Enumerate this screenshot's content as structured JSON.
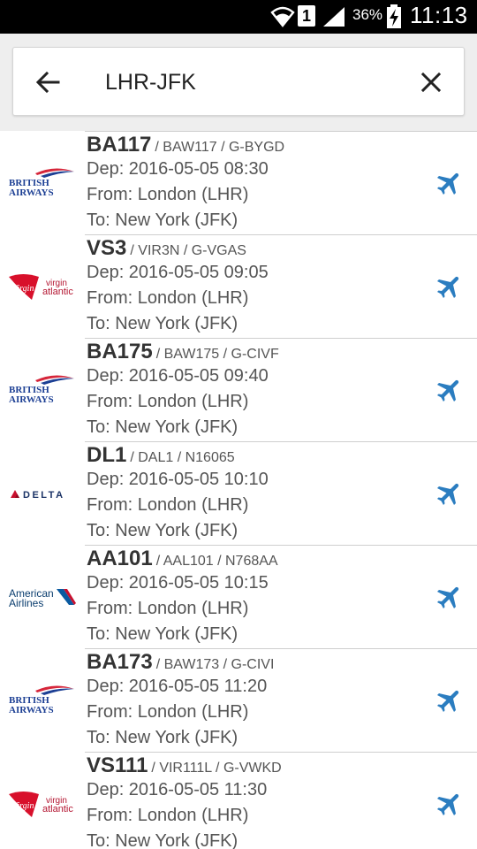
{
  "status_bar": {
    "sim_label": "1",
    "battery_percent": "36%",
    "time": "11:13",
    "icons": [
      "wifi-icon",
      "signal-icon",
      "battery-charging-icon"
    ]
  },
  "search": {
    "value": "LHR-JFK",
    "back_icon": "arrow-left-icon",
    "clear_icon": "close-icon"
  },
  "colors": {
    "plane_icon": "#2b7dc0",
    "ba_blue": "#1c3f94",
    "ba_red": "#d6263a",
    "virgin_red": "#d8102b",
    "delta_red": "#c8102e",
    "delta_blue": "#1b3366",
    "aa_blue": "#0a5aa0",
    "aa_red": "#c8102e"
  },
  "flights": [
    {
      "airline": "British Airways",
      "logo_text": [
        "BRITISH",
        "AIRWAYS"
      ],
      "number": "BA117",
      "ids": "/ BAW117 / G-BYGD",
      "dep": "Dep: 2016-05-05 08:30",
      "from": "From: London (LHR)",
      "to": "To: New York (JFK)"
    },
    {
      "airline": "Virgin Atlantic",
      "logo_text": [
        "Virgin",
        "virgin",
        "atlantic"
      ],
      "number": "VS3",
      "ids": "/ VIR3N / G-VGAS",
      "dep": "Dep: 2016-05-05 09:05",
      "from": "From: London (LHR)",
      "to": "To: New York (JFK)"
    },
    {
      "airline": "British Airways",
      "logo_text": [
        "BRITISH",
        "AIRWAYS"
      ],
      "number": "BA175",
      "ids": "/ BAW175 / G-CIVF",
      "dep": "Dep: 2016-05-05 09:40",
      "from": "From: London (LHR)",
      "to": "To: New York (JFK)"
    },
    {
      "airline": "Delta",
      "logo_text": [
        "DELTA"
      ],
      "number": "DL1",
      "ids": "/ DAL1 / N16065",
      "dep": "Dep: 2016-05-05 10:10",
      "from": "From: London (LHR)",
      "to": "To: New York (JFK)"
    },
    {
      "airline": "American Airlines",
      "logo_text": [
        "American",
        "Airlines"
      ],
      "number": "AA101",
      "ids": "/ AAL101 / N768AA",
      "dep": "Dep: 2016-05-05 10:15",
      "from": "From: London (LHR)",
      "to": "To: New York (JFK)"
    },
    {
      "airline": "British Airways",
      "logo_text": [
        "BRITISH",
        "AIRWAYS"
      ],
      "number": "BA173",
      "ids": "/ BAW173 / G-CIVI",
      "dep": "Dep: 2016-05-05 11:20",
      "from": "From: London (LHR)",
      "to": "To: New York (JFK)"
    },
    {
      "airline": "Virgin Atlantic",
      "logo_text": [
        "Virgin",
        "virgin",
        "atlantic"
      ],
      "number": "VS111",
      "ids": "/ VIR111L / G-VWKD",
      "dep": "Dep: 2016-05-05 11:30",
      "from": "From: London (LHR)",
      "to": "To: New York (JFK)"
    }
  ]
}
